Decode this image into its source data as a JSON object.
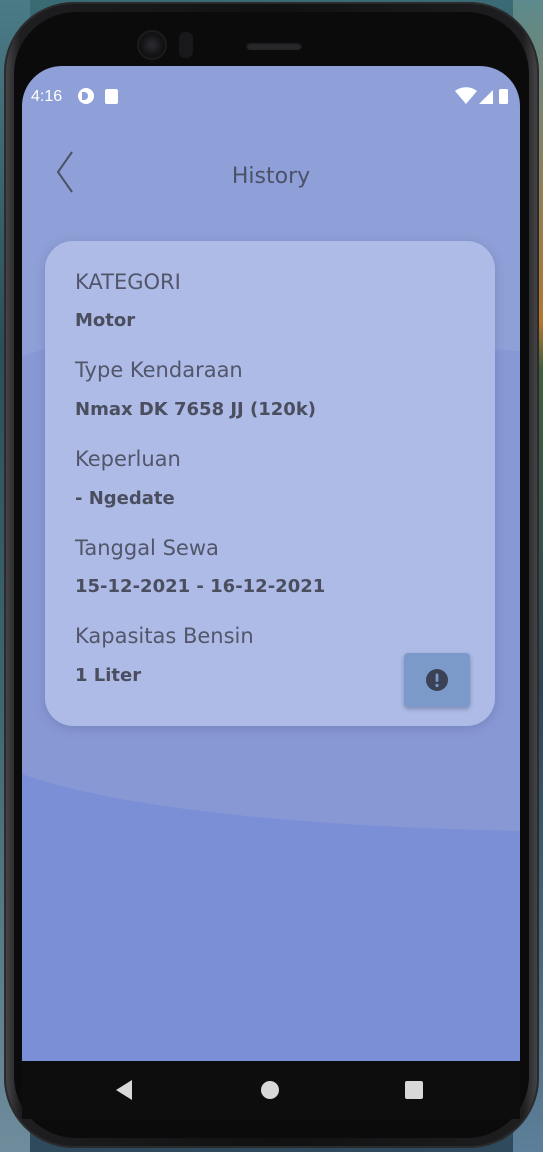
{
  "status_bar": {
    "time": "4:16"
  },
  "header": {
    "title": "History",
    "back_icon": "chevron-left-icon"
  },
  "card": {
    "fields": [
      {
        "label": "KATEGORI",
        "value": "Motor"
      },
      {
        "label": "Type Kendaraan",
        "value": "Nmax DK 7658 JJ (120k)"
      },
      {
        "label": "Keperluan",
        "value": "- Ngedate"
      },
      {
        "label": "Tanggal Sewa",
        "value": "15-12-2021 - 16-12-2021"
      },
      {
        "label": "Kapasitas Bensin",
        "value": "1 Liter"
      }
    ],
    "info_icon": "exclamation-circle-icon"
  },
  "nav_bar": {
    "back_icon": "triangle-back-icon",
    "home_icon": "circle-home-icon",
    "recents_icon": "square-recents-icon"
  },
  "colors": {
    "screen_bg": "#8fa0d8",
    "card_bg": "#aebbe6",
    "wave_bg": "#7b8fd6",
    "button_bg": "#7c9ac9",
    "text": "#4a4e5f"
  }
}
